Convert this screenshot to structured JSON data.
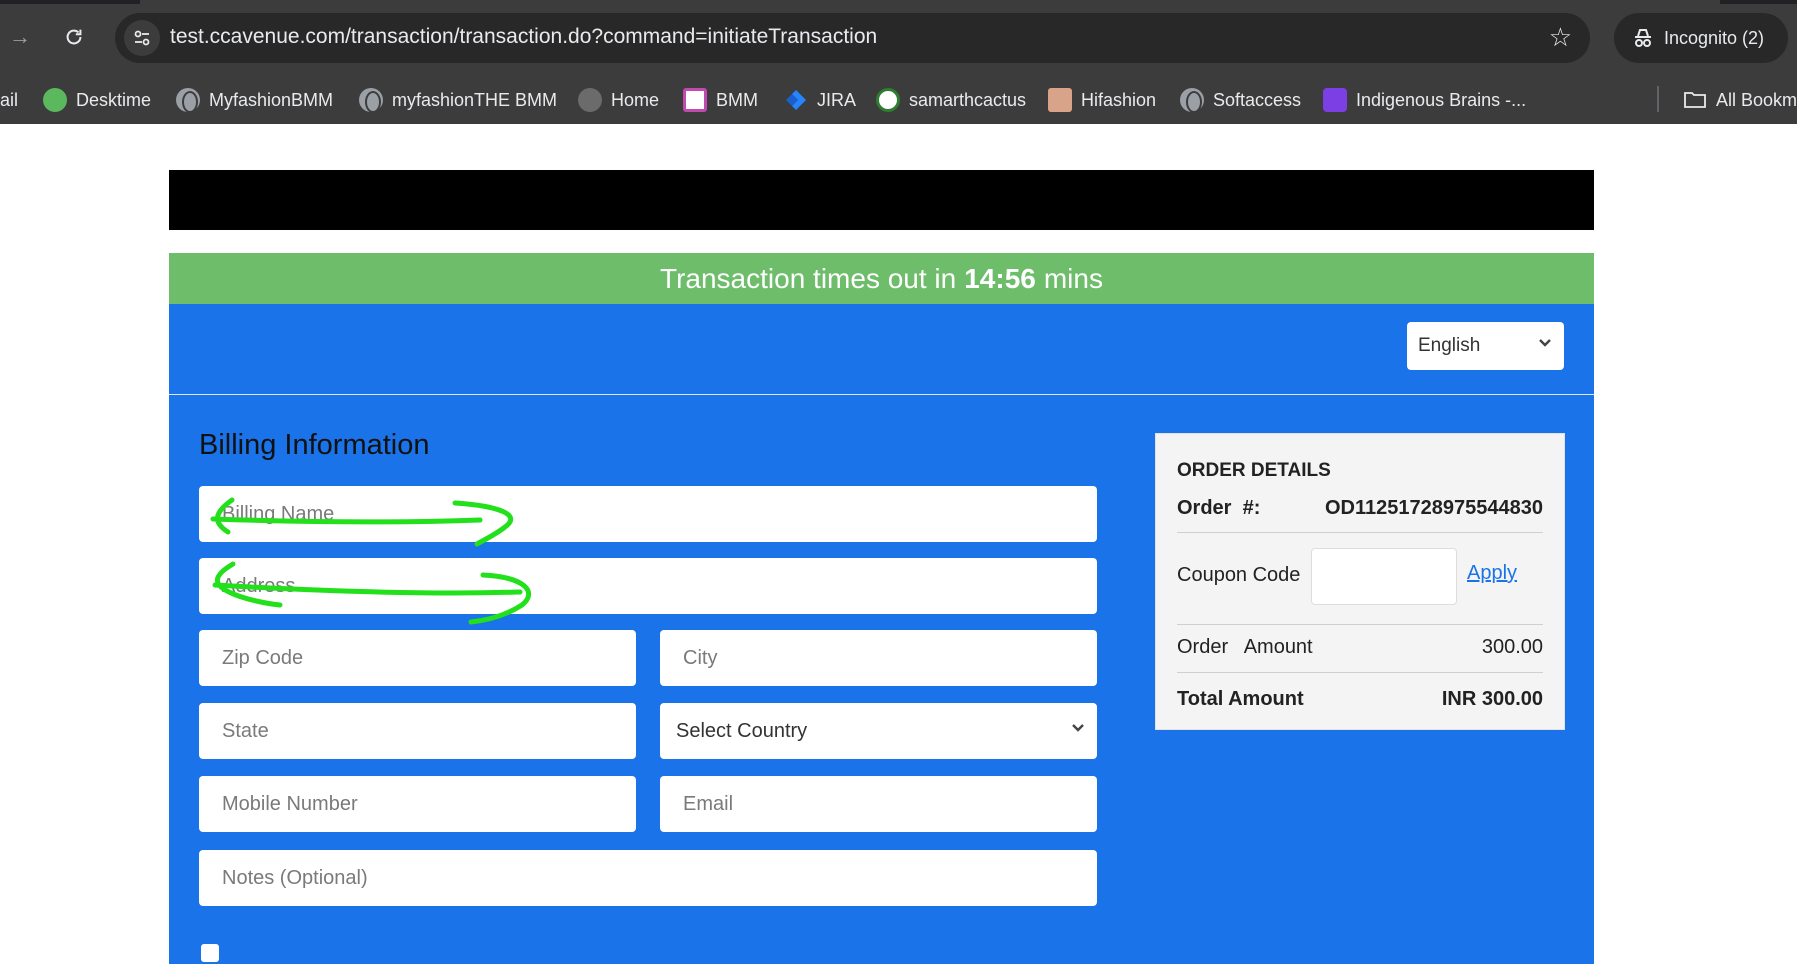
{
  "browser": {
    "url": "test.ccavenue.com/transaction/transaction.do?command=initiateTransaction",
    "incognito_label": "Incognito (2)",
    "bookmarks": [
      {
        "label": "ail"
      },
      {
        "label": "Desktime"
      },
      {
        "label": "MyfashionBMM"
      },
      {
        "label": "myfashionTHE BMM"
      },
      {
        "label": "Home"
      },
      {
        "label": "BMM"
      },
      {
        "label": "JIRA"
      },
      {
        "label": "samarthcactus"
      },
      {
        "label": "Hifashion"
      },
      {
        "label": "Softaccess"
      },
      {
        "label": "Indigenous Brains -..."
      }
    ],
    "all_bookmarks_label": "All Bookm"
  },
  "timer": {
    "prefix": "Transaction times out in",
    "time": "14:56",
    "suffix": "mins"
  },
  "language": {
    "selected": "English"
  },
  "billing": {
    "title": "Billing Information",
    "name_placeholder": "Billing Name",
    "address_placeholder": "Address",
    "zip_placeholder": "Zip Code",
    "city_placeholder": "City",
    "state_placeholder": "State",
    "country_selected": "Select Country",
    "mobile_placeholder": "Mobile Number",
    "email_placeholder": "Email",
    "notes_placeholder": "Notes (Optional)"
  },
  "order": {
    "title": "ORDER DETAILS",
    "order_no_label": "Order  #:",
    "order_no_value": "OD11251728975544830",
    "coupon_label": "Coupon Code",
    "apply_label": "Apply",
    "amount_label": "Order   Amount",
    "amount_value": "300.00",
    "total_label": "Total Amount",
    "total_value": "INR 300.00"
  },
  "colors": {
    "panel_blue": "#1a73e8",
    "timer_green": "#6dbd6a",
    "annotation_green": "#22e01a"
  }
}
